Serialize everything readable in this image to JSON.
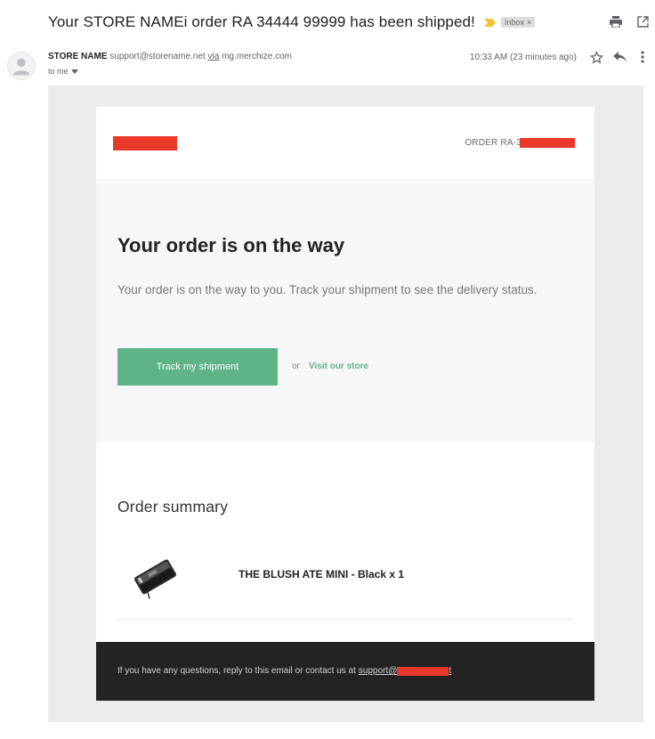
{
  "header": {
    "subject": "Your STORE NAMEi order RA  34444  99999 has been shipped!",
    "label_chip": "Inbox",
    "label_chip_close": "×"
  },
  "sender": {
    "name": "STORE NAME",
    "email": "support@storename.net",
    "via_label": "via",
    "via_domain": "mg.merchize.com",
    "recipient": "to me",
    "timestamp": "10:33 AM (23 minutes ago)"
  },
  "email": {
    "order_prefix": "ORDER RA-3",
    "hero_title": "Your order is on the way",
    "hero_text": "Your order is on the way to you. Track your shipment to see the delivery status.",
    "track_button": "Track my shipment",
    "or_text": "or",
    "visit_link": "Visit our store",
    "summary_title": "Order summary",
    "product_name": "THE BLUSH ATE MINI - Black x 1",
    "footer_text": "If you have any questions, reply to this email or contact us at",
    "footer_link_prefix": "support@",
    "footer_link_suffix": "t"
  },
  "colors": {
    "accent_green": "#5fb389",
    "redaction_red": "#e8392b",
    "footer_bg": "#232323",
    "hero_bg": "#f7f7f7",
    "outer_bg": "#ebebeb"
  },
  "icons": [
    "importance-marker-icon",
    "print-icon",
    "open-in-new-window-icon",
    "avatar-person-icon",
    "chevron-down-icon",
    "star-icon",
    "reply-icon",
    "more-vertical-icon",
    "product-wallet-image"
  ]
}
